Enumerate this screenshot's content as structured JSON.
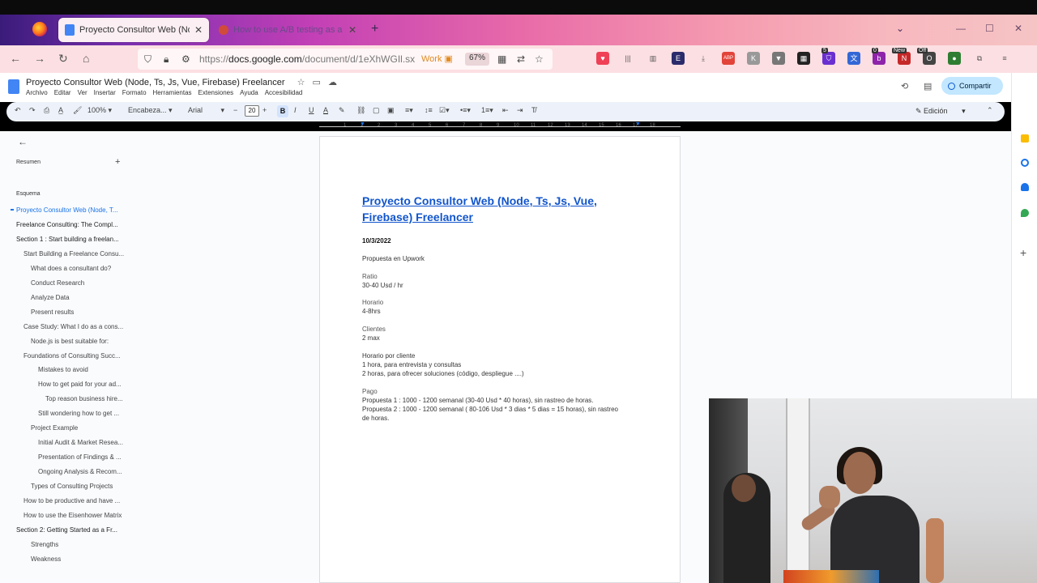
{
  "browser": {
    "tabs": [
      {
        "title": "Proyecto Consultor Web (Node, Ts, Js, Vue, Firebase) Freelancer - Documentos de Google",
        "active": true
      },
      {
        "title": "How to use A/B testing as a consultant",
        "active": false
      }
    ],
    "url": {
      "scheme": "https://",
      "host": "docs.google.com",
      "path": "/document/d/1eXhWGIl.sx"
    },
    "container_label": "Work",
    "zoom": "67%",
    "extensions": [
      {
        "name": "pocket-icon",
        "color": "#ef4056"
      },
      {
        "name": "library-icon",
        "color": "#555555"
      },
      {
        "name": "sidebar-icon",
        "color": "#555555"
      },
      {
        "name": "e-extension-icon",
        "color": "#2b2b6b"
      },
      {
        "name": "download-icon",
        "color": "#666666"
      },
      {
        "name": "adblock-icon",
        "color": "#e2443a"
      },
      {
        "name": "k-extension-icon",
        "color": "#999999"
      },
      {
        "name": "v-extension-icon",
        "color": "#777777"
      },
      {
        "name": "grid-extension-icon",
        "color": "#222222"
      },
      {
        "name": "shield-extension-icon",
        "color": "#6a2fd0"
      },
      {
        "name": "translate-extension-icon",
        "color": "#3367d6"
      },
      {
        "name": "b-extension-icon",
        "color": "#8e24aa"
      },
      {
        "name": "new-extension-icon",
        "color": "#c62828"
      },
      {
        "name": "off-extension-icon",
        "color": "#444444"
      },
      {
        "name": "green-extension-icon",
        "color": "#2e7d32"
      },
      {
        "name": "puzzle-icon",
        "color": "#555555"
      },
      {
        "name": "menu-icon",
        "color": "#555555"
      }
    ],
    "badges": {
      "shield": "5",
      "translate": "0",
      "new": "New",
      "off": "Off"
    }
  },
  "docs": {
    "title": "Proyecto Consultor Web (Node, Ts, Js, Vue, Firebase) Freelancer",
    "menu": [
      "Archivo",
      "Editar",
      "Ver",
      "Insertar",
      "Formato",
      "Herramientas",
      "Extensiones",
      "Ayuda",
      "Accesibilidad"
    ],
    "share_label": "Compartir",
    "toolbar": {
      "zoom": "100%",
      "style": "Encabeza...",
      "font": "Arial",
      "font_size": "20",
      "edit_mode": "Edición"
    },
    "ruler_ticks": [
      "1",
      "1",
      "2",
      "3",
      "4",
      "5",
      "6",
      "7",
      "8",
      "9",
      "10",
      "11",
      "12",
      "13",
      "14",
      "15",
      "16",
      "17",
      "18"
    ]
  },
  "outline": {
    "summary_label": "Resumen",
    "outline_label": "Esquema",
    "items": [
      {
        "label": "Proyecto Consultor Web (Node, T...",
        "level": 0,
        "current": true
      },
      {
        "label": "Freelance Consulting: The Compl...",
        "level": 0
      },
      {
        "label": "Section 1 : Start building a freelan...",
        "level": 0
      },
      {
        "label": "Start Building a Freelance Consu...",
        "level": 1
      },
      {
        "label": "What does a consultant do?",
        "level": 2
      },
      {
        "label": "Conduct Research",
        "level": 2
      },
      {
        "label": "Analyze Data",
        "level": 2
      },
      {
        "label": "Present results",
        "level": 2
      },
      {
        "label": "Case Study: What I do as a cons...",
        "level": 1
      },
      {
        "label": "Node.js is best suitable for:",
        "level": 2
      },
      {
        "label": "Foundations of Consulting Succ...",
        "level": 1
      },
      {
        "label": "Mistakes to avoid",
        "level": 3
      },
      {
        "label": "How to get paid for your ad...",
        "level": 3
      },
      {
        "label": "Top reason business hire...",
        "level": 4
      },
      {
        "label": "Still wondering how to get ...",
        "level": 3
      },
      {
        "label": "Project Example",
        "level": 2
      },
      {
        "label": "Initial Audit & Market Resea...",
        "level": 3
      },
      {
        "label": "Presentation of Findings & ...",
        "level": 3
      },
      {
        "label": "Ongoing Analysis & Recom...",
        "level": 3
      },
      {
        "label": "Types of Consulting Projects",
        "level": 2
      },
      {
        "label": "How to be productive and have ...",
        "level": 1
      },
      {
        "label": "How to use the Eisenhower Matrix",
        "level": 1
      },
      {
        "label": "Section 2: Getting Started as a Fr...",
        "level": 0
      },
      {
        "label": "Strengths",
        "level": 2
      },
      {
        "label": "Weakness",
        "level": 2
      }
    ]
  },
  "document": {
    "heading": "Proyecto Consultor Web (Node, Ts, Js, Vue, Firebase) Freelancer",
    "date": "10/3/2022",
    "lines": [
      {
        "text": "Propuesta en Upwork",
        "style": "normal"
      },
      {
        "text": "Ratio",
        "style": "label"
      },
      {
        "text": "30-40 Usd / hr",
        "style": "normal"
      },
      {
        "text": "Horario",
        "style": "label"
      },
      {
        "text": "4-8hrs",
        "style": "normal"
      },
      {
        "text": "Clientes",
        "style": "label"
      },
      {
        "text": "2 max",
        "style": "normal"
      },
      {
        "text": "Horario por cliente",
        "style": "normal"
      },
      {
        "text": "1 hora, para entrevista y consultas",
        "style": "normal"
      },
      {
        "text": "2 horas, para ofrecer soluciones (código, despliegue ....)",
        "style": "normal"
      },
      {
        "text": "Pago",
        "style": "label"
      },
      {
        "text": "Propuesta 1 :  1000 - 1200 semanal (30-40 Usd * 40 horas), sin rastreo de horas.",
        "style": "normal"
      },
      {
        "text": "Propuesta 2 :  1000 - 1200 semanal ( 80-106 Usd *  3 dias * 5 dias = 15 horas), sin rastreo",
        "style": "normal"
      },
      {
        "text": "de horas.",
        "style": "normal"
      }
    ]
  },
  "colors": {
    "link_blue": "#1155cc",
    "accent_blue": "#1a73e8",
    "share_bg": "#c2e7ff"
  }
}
